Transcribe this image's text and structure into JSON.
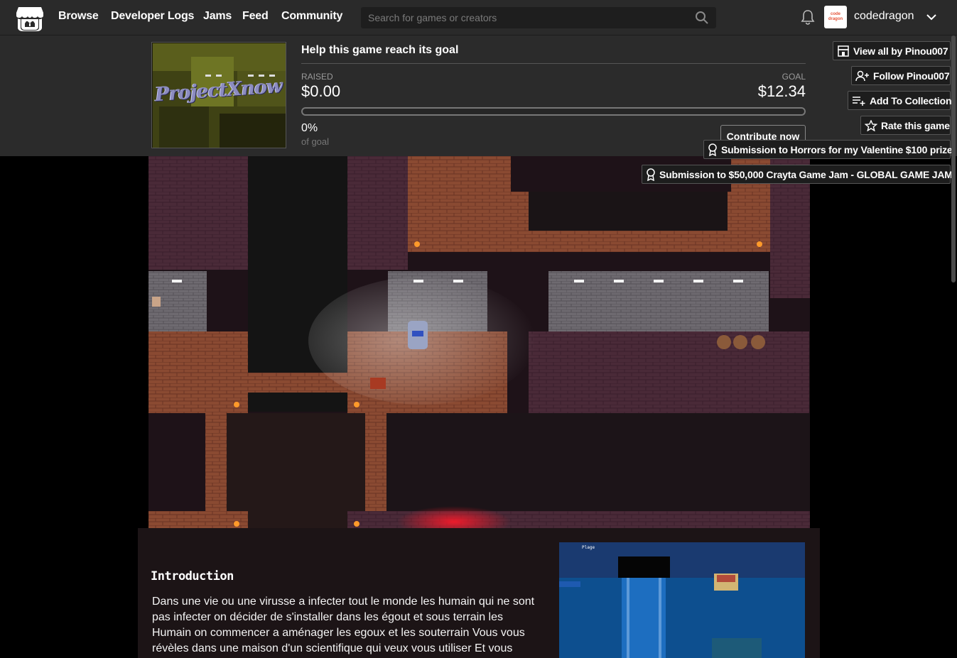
{
  "nav": {
    "links": [
      "Browse",
      "Developer Logs",
      "Jams",
      "Feed",
      "Community"
    ],
    "search_placeholder": "Search for games or creators",
    "avatar_text": "code dragon",
    "username": "codedragon"
  },
  "funding": {
    "thumbnail_text": "ProjectXnow",
    "title": "Help this game reach its goal",
    "raised_label": "RAISED",
    "raised_value": "$0.00",
    "goal_label": "GOAL",
    "goal_value": "$12.34",
    "progress_fraction": 0,
    "percent": "0%",
    "of_goal": "of goal",
    "contribute_label": "Contribute now"
  },
  "actions": {
    "view_all": "View all by Pinou007",
    "follow": "Follow Pinou007",
    "add_collection": "Add To Collection",
    "rate": "Rate this game",
    "submission_1": "Submission to Horrors for my Valentine $100 prize",
    "submission_2": "Submission to $50,000 Crayta Game Jam - GLOBAL GAME JAM!"
  },
  "description": {
    "heading": "Introduction",
    "body": "Dans une vie ou une virusse a infecter tout le monde les humain qui ne sont pas infecter on décider de s'installer dans les égout et sous terrain les Humain on commencer a aménager les egoux et les souterrain Vous vous révèles dans une maison d'un scientifique qui veux vous utiliser Et vous",
    "screenshot_label": "Plage"
  },
  "colors": {
    "topbar": "#2a2a2a",
    "panel": "#2b2b2b",
    "desc_bg": "#1c1416"
  }
}
